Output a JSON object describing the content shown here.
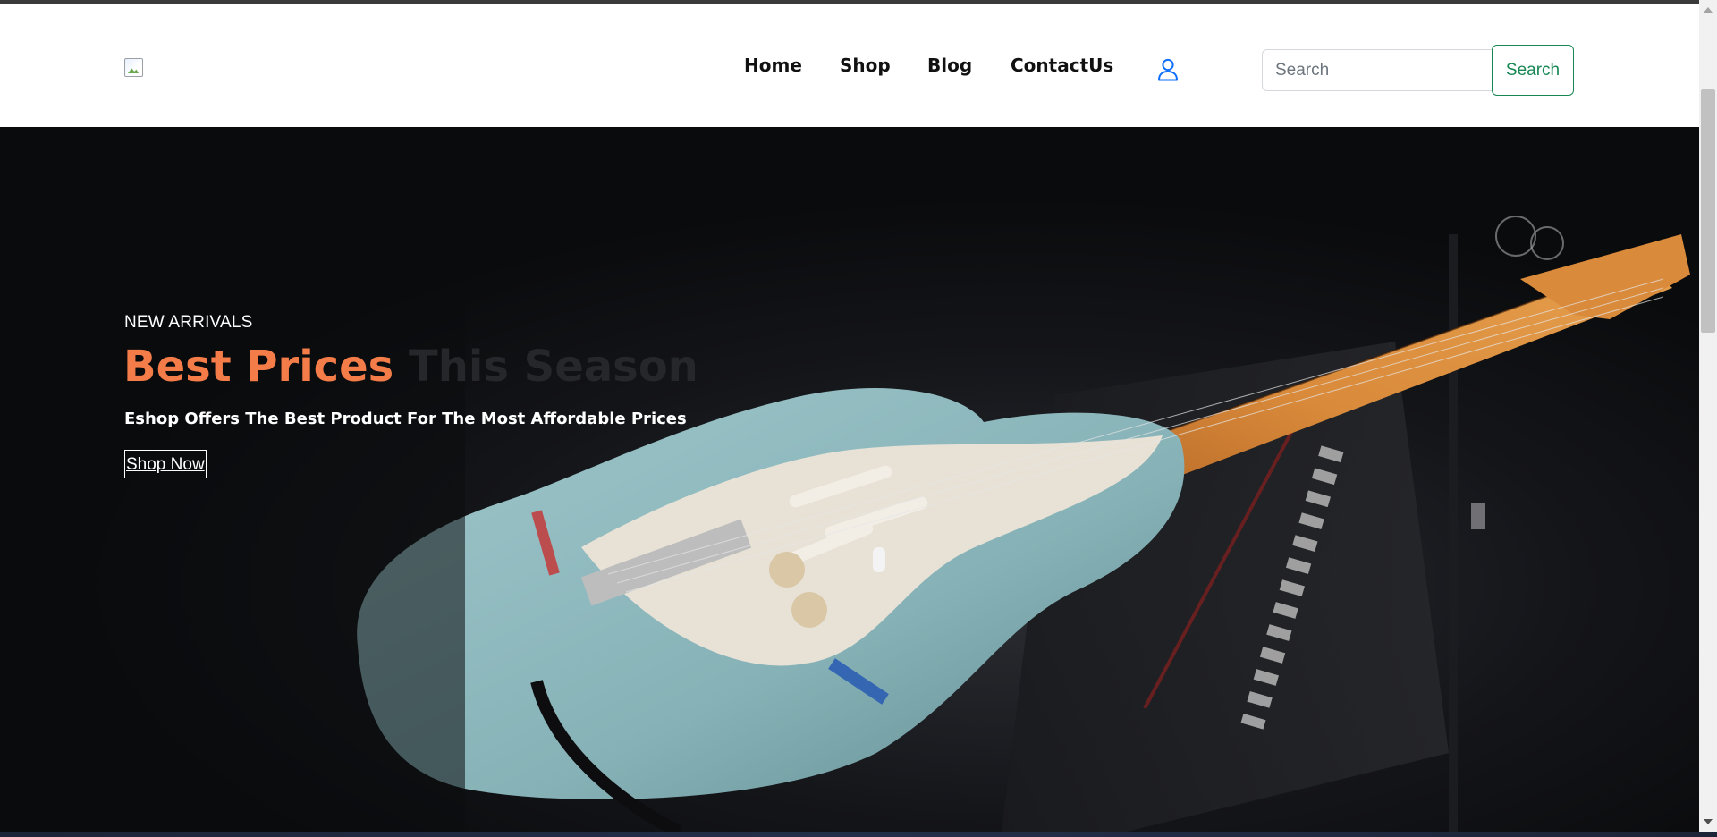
{
  "navbar": {
    "links": [
      "Home",
      "Shop",
      "Blog",
      "ContactUs"
    ],
    "search": {
      "placeholder": "Search",
      "button_label": "Search"
    }
  },
  "hero": {
    "eyebrow": "NEW ARRIVALS",
    "title_accent": "Best Prices",
    "title_rest": "This Season",
    "subtitle": "Eshop Offers The Best Product For The Most Affordable Prices",
    "cta_label": "Shop Now"
  },
  "icons": {
    "logo": "broken-image-icon",
    "user": "user-icon"
  },
  "colors": {
    "accent_orange": "#f47c48",
    "success_green": "#198754",
    "user_icon_blue": "#0d6efd",
    "hero_background": "#0e0f12",
    "guitar_body": "#8fb8bc"
  }
}
